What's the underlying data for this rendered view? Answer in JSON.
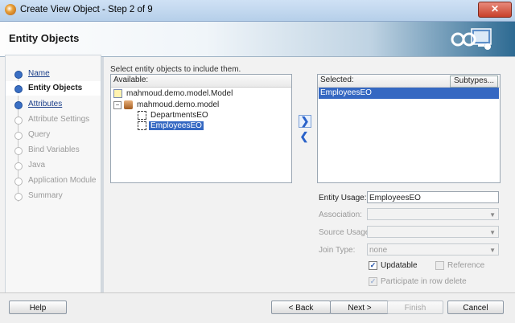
{
  "window": {
    "title": "Create View Object - Step 2 of 9",
    "close_label": "✕"
  },
  "header": {
    "title": "Entity Objects"
  },
  "steps": [
    {
      "label": "Name",
      "state": "done"
    },
    {
      "label": "Entity Objects",
      "state": "active"
    },
    {
      "label": "Attributes",
      "state": "done"
    },
    {
      "label": "Attribute Settings",
      "state": "disabled"
    },
    {
      "label": "Query",
      "state": "disabled"
    },
    {
      "label": "Bind Variables",
      "state": "disabled"
    },
    {
      "label": "Java",
      "state": "disabled"
    },
    {
      "label": "Application Module",
      "state": "disabled"
    },
    {
      "label": "Summary",
      "state": "disabled"
    }
  ],
  "main": {
    "instruction": "Select entity objects to include them.",
    "available": {
      "header": "Available:",
      "tree": [
        {
          "label": "mahmoud.demo.model.Model",
          "type": "model"
        },
        {
          "label": "mahmoud.demo.model",
          "type": "package",
          "expanded": true
        },
        {
          "label": "DepartmentsEO",
          "type": "entity",
          "selected": false
        },
        {
          "label": "EmployeesEO",
          "type": "entity",
          "selected": true
        }
      ]
    },
    "shuttle": {
      "add": "❯",
      "remove": "❮"
    },
    "selected": {
      "header": "Selected:",
      "subtypes_label": "Subtypes...",
      "items": [
        "EmployeesEO"
      ]
    },
    "form": {
      "entity_usage_label": "Entity Usage:",
      "entity_usage_value": "EmployeesEO",
      "association_label": "Association:",
      "association_value": "",
      "source_usage_label": "Source Usage:",
      "source_usage_value": "",
      "join_type_label": "Join Type:",
      "join_type_value": "none",
      "updatable_label": "Updatable",
      "updatable_checked": true,
      "reference_label": "Reference",
      "reference_checked": false,
      "participate_label": "Participate in row delete",
      "participate_checked": true
    }
  },
  "footer": {
    "help": "Help",
    "back": "< Back",
    "next": "Next >",
    "finish": "Finish",
    "cancel": "Cancel"
  },
  "colors": {
    "selection": "#3568c2",
    "header_accent": "#2d6a92"
  }
}
